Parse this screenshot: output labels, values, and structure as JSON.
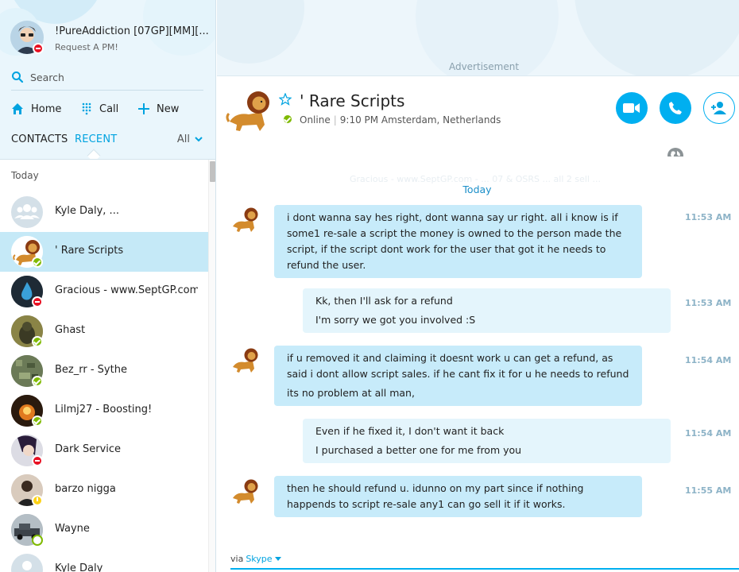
{
  "profile": {
    "name": "!PureAddiction [07GP][MM][...",
    "mood": "Request A PM!",
    "status": "dnd"
  },
  "search": {
    "placeholder": "Search"
  },
  "nav": {
    "home": "Home",
    "call": "Call",
    "new": "New"
  },
  "list_tabs": {
    "contacts": "CONTACTS",
    "recent": "RECENT",
    "filter": "All"
  },
  "recent_list": {
    "section": "Today",
    "contacts": [
      {
        "name": "Kyle Daly, ...",
        "status": "none",
        "avatar": "group"
      },
      {
        "name": "' Rare Scripts",
        "status": "online",
        "avatar": "lion",
        "selected": true
      },
      {
        "name": "Gracious - www.SeptGP.com...",
        "status": "dnd",
        "avatar": "drop"
      },
      {
        "name": "Ghast",
        "status": "online",
        "avatar": "photo-green"
      },
      {
        "name": "Bez_rr - Sythe",
        "status": "online",
        "avatar": "photo-map"
      },
      {
        "name": "Lilmj27 - Boosting!",
        "status": "online",
        "avatar": "photo-fire"
      },
      {
        "name": "Dark Service",
        "status": "dnd",
        "avatar": "photo-dark"
      },
      {
        "name": "barzo nigga",
        "status": "away",
        "avatar": "photo-person"
      },
      {
        "name": "Wayne",
        "status": "offline",
        "avatar": "photo-truck"
      },
      {
        "name": "Kyle Daly",
        "status": "none",
        "avatar": "person"
      }
    ]
  },
  "ad": {
    "label": "Advertisement"
  },
  "chat": {
    "title": "' Rare Scripts",
    "status_text": "Online",
    "location": "9:10 PM Amsterdam, Netherlands",
    "faded_line": "Gracious - www.SeptGP.com - ... 07 & OSRS ... all 2 sell ...",
    "day": "Today",
    "messages": [
      {
        "dir": "in",
        "time": "11:53 AM",
        "lines": [
          "i dont wanna say hes right, dont wanna say ur right. all i know is if some1 re-sale a script the money is owned to the person made the script, if the script dont work for the user that got it he needs to refund the user."
        ]
      },
      {
        "dir": "out",
        "time": "11:53 AM",
        "lines": [
          "Kk, then I'll ask for a refund",
          "I'm sorry we got you involved :S"
        ]
      },
      {
        "dir": "in",
        "time": "11:54 AM",
        "lines": [
          "if u removed it and claiming it doesnt work u can get a refund, as said i dont allow script sales. if he cant fix it for u he needs to refund",
          "its no problem at all man,"
        ]
      },
      {
        "dir": "out",
        "time": "11:54 AM",
        "lines": [
          "Even if he fixed it, I don't want it back",
          "I purchased a better one for me from you"
        ]
      },
      {
        "dir": "in",
        "time": "11:55 AM",
        "lines": [
          "then he should refund u. idunno on my part since if nothing happends to script re-sale any1 can go sell it if it works."
        ]
      }
    ]
  },
  "composer": {
    "via": "via",
    "service": "Skype"
  },
  "colors": {
    "accent": "#00aff0",
    "selected": "#c5e9f7",
    "in_bubble": "#c7ebfa",
    "out_bubble": "#e4f5fc",
    "online": "#7fba00",
    "dnd": "#e81123",
    "away": "#fcd116"
  }
}
